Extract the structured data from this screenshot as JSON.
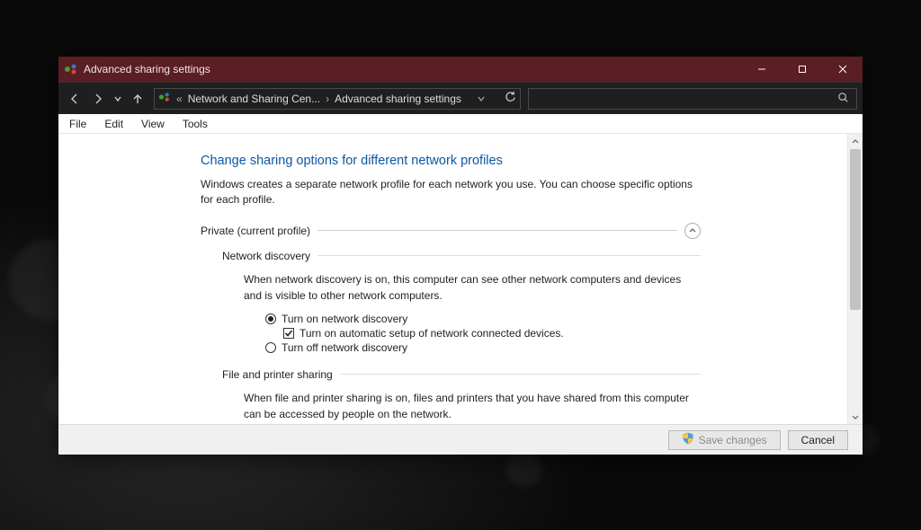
{
  "window": {
    "title": "Advanced sharing settings"
  },
  "breadcrumb": {
    "item1": "Network and Sharing Cen...",
    "item2": "Advanced sharing settings"
  },
  "menu": {
    "file": "File",
    "edit": "Edit",
    "view": "View",
    "tools": "Tools"
  },
  "page": {
    "heading": "Change sharing options for different network profiles",
    "description": "Windows creates a separate network profile for each network you use. You can choose specific options for each profile."
  },
  "sections": {
    "private": {
      "label": "Private (current profile)",
      "network_discovery": {
        "title": "Network discovery",
        "description": "When network discovery is on, this computer can see other network computers and devices and is visible to other network computers.",
        "opt_on": "Turn on network discovery",
        "opt_on_selected": true,
        "chk_auto": "Turn on automatic setup of network connected devices.",
        "chk_auto_checked": true,
        "opt_off": "Turn off network discovery",
        "opt_off_selected": false
      },
      "file_printer": {
        "title": "File and printer sharing",
        "description": "When file and printer sharing is on, files and printers that you have shared from this computer can be accessed by people on the network."
      }
    }
  },
  "footer": {
    "save": "Save changes",
    "cancel": "Cancel"
  }
}
